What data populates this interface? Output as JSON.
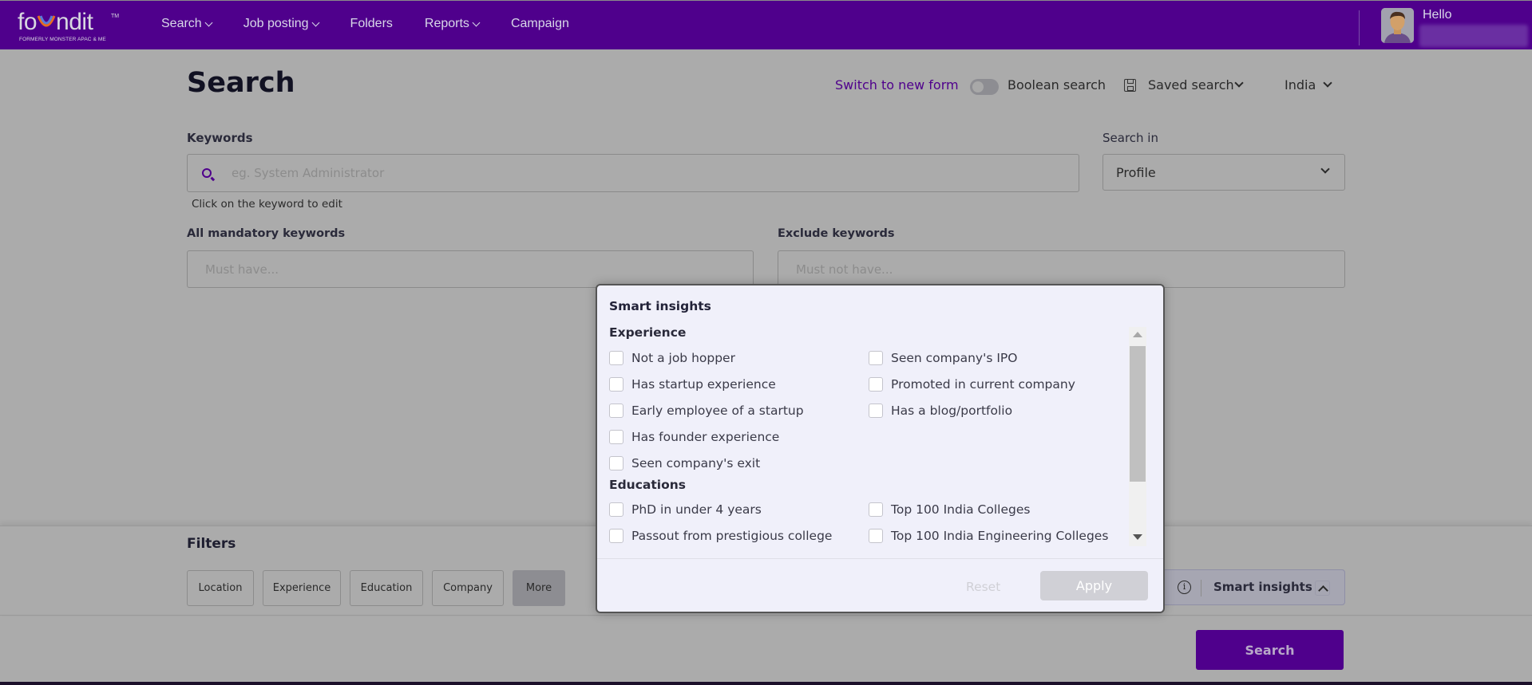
{
  "header": {
    "logo": {
      "word": "foundit",
      "tm": "TM",
      "subtitle": "FORMERLY MONSTER APAC & ME"
    },
    "nav": [
      {
        "label": "Search",
        "has_dropdown": true
      },
      {
        "label": "Job posting",
        "has_dropdown": true
      },
      {
        "label": "Folders",
        "has_dropdown": false
      },
      {
        "label": "Reports",
        "has_dropdown": true
      },
      {
        "label": "Campaign",
        "has_dropdown": false
      }
    ],
    "greeting": "Hello",
    "user_name_blurred": true,
    "avatar_icon": "user-avatar-icon"
  },
  "page": {
    "title": "Search",
    "switch_form_link": "Switch to new form",
    "boolean_search": {
      "label": "Boolean search",
      "enabled": false
    },
    "saved_search": {
      "label": "Saved search",
      "icon": "save-icon"
    },
    "country": "India"
  },
  "keywords": {
    "label": "Keywords",
    "placeholder": "eg. System Administrator",
    "value": "",
    "hint": "Click on the keyword to edit"
  },
  "search_in": {
    "label": "Search in",
    "selected": "Profile"
  },
  "mandatory": {
    "label": "All mandatory keywords",
    "placeholder": "Must have..."
  },
  "exclude": {
    "label": "Exclude keywords",
    "placeholder": "Must not have..."
  },
  "filters": {
    "title": "Filters",
    "chips": [
      "Location",
      "Experience",
      "Education",
      "Company",
      "More"
    ],
    "smart_insights": {
      "label": "Smart insights",
      "expanded": true
    }
  },
  "search_button": "Search",
  "modal": {
    "title": "Smart insights",
    "sections": [
      {
        "heading": "Experience",
        "left": [
          "Not a job hopper",
          "Has startup experience",
          "Early employee of a startup",
          "Has founder experience",
          "Seen company's exit"
        ],
        "right": [
          "Seen company's IPO",
          "Promoted in current company",
          "Has a blog/portfolio"
        ]
      },
      {
        "heading": "Educations",
        "left": [
          "PhD in under 4 years",
          "Passout from prestigious college"
        ],
        "right": [
          "Top 100 India Colleges",
          "Top 100 India Engineering Colleges"
        ]
      }
    ],
    "reset_label": "Reset",
    "apply_label": "Apply"
  },
  "colors": {
    "brand": "#4f008c",
    "overlay": "#ababab",
    "modal_bg": "#f0f0fa"
  }
}
